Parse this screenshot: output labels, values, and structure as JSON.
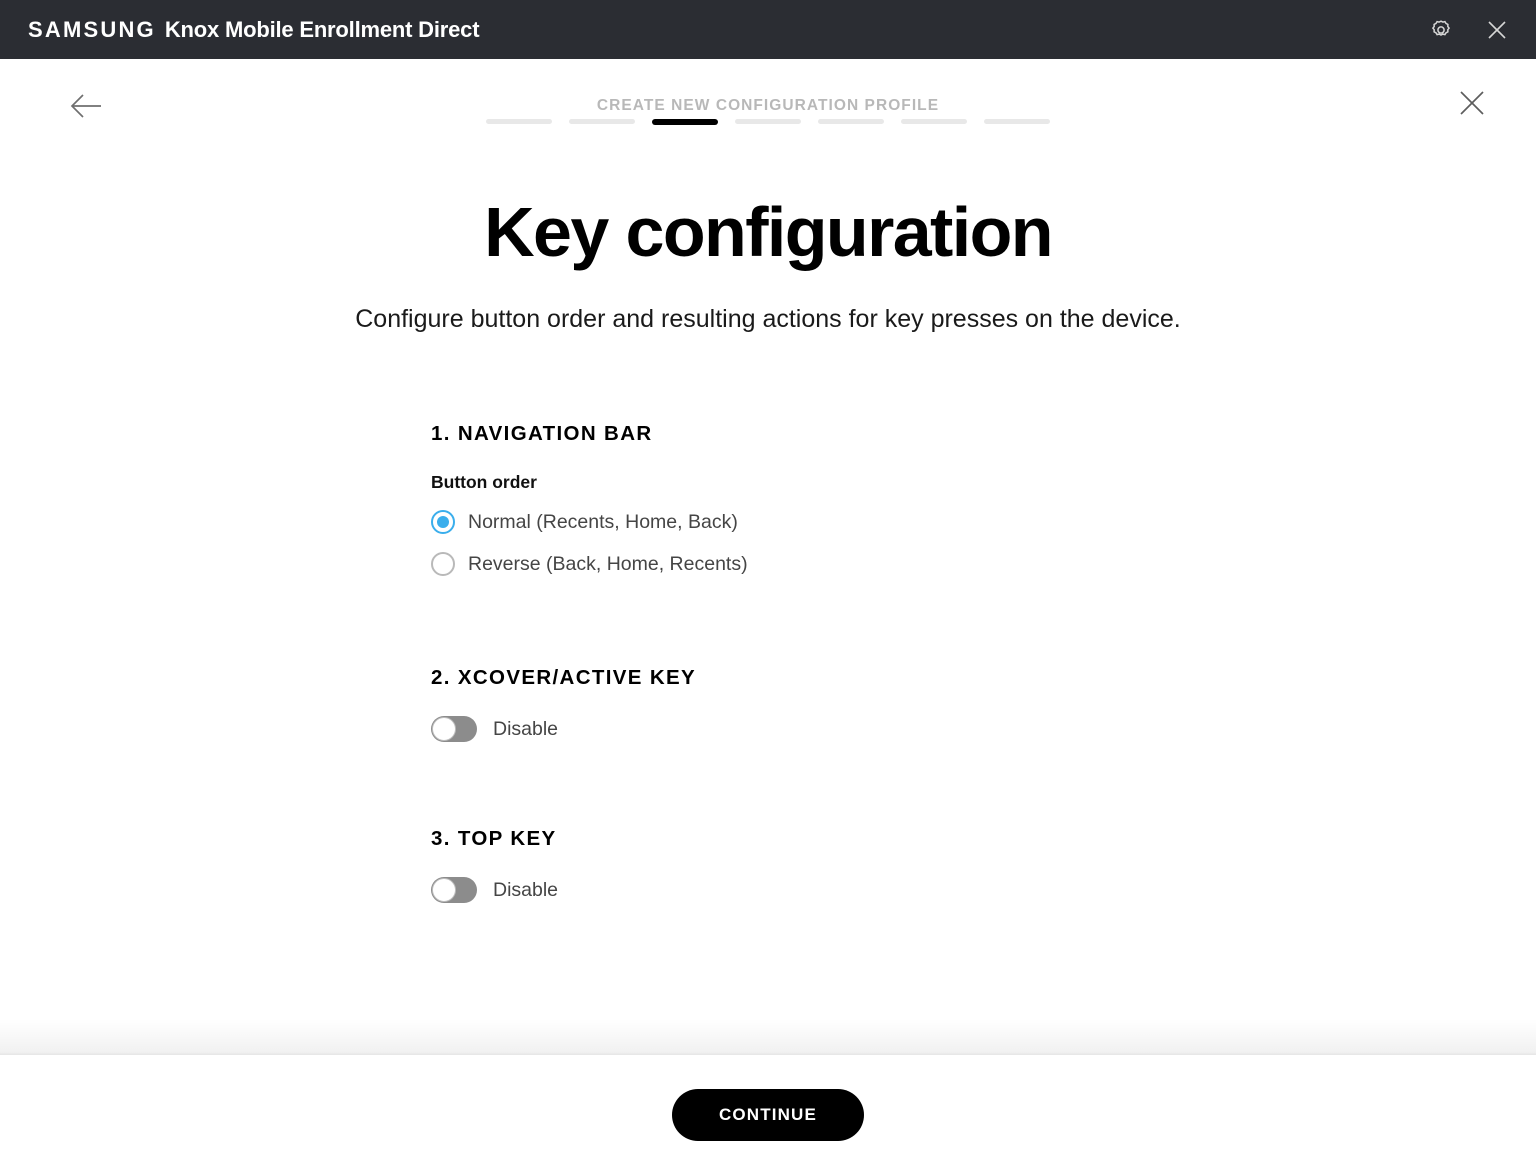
{
  "titlebar": {
    "brand": "SAMSUNG",
    "app_name": "Knox Mobile Enrollment Direct",
    "settings_icon": "gear-icon",
    "close_icon": "close-icon",
    "background_color": "#2b2d33"
  },
  "wizard": {
    "back_icon": "arrow-left-icon",
    "close_icon": "close-icon",
    "title": "CREATE NEW CONFIGURATION PROFILE",
    "steps": {
      "total": 7,
      "active_index": 3
    }
  },
  "hero": {
    "title": "Key configuration",
    "subtitle": "Configure button order and resulting actions for key presses on the device."
  },
  "sections": [
    {
      "heading": "1. NAVIGATION BAR",
      "field_label": "Button order",
      "options": [
        {
          "label": "Normal (Recents, Home, Back)",
          "selected": true
        },
        {
          "label": "Reverse (Back, Home, Recents)",
          "selected": false
        }
      ]
    },
    {
      "heading": "2. XCOVER/ACTIVE KEY",
      "toggle_label": "Disable",
      "toggle_on": false
    },
    {
      "heading": "3. TOP KEY",
      "toggle_label": "Disable",
      "toggle_on": false
    }
  ],
  "footer": {
    "continue_label": "CONTINUE"
  },
  "colors": {
    "accent": "#3aaeec",
    "titlebar": "#2b2d33",
    "step_inactive": "#e8e8e8",
    "step_active": "#000000",
    "toggle_off": "#8c8c8c"
  }
}
